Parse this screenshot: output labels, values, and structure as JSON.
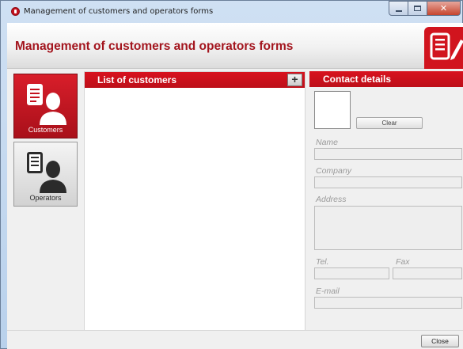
{
  "window": {
    "title": "Management of customers and operators forms",
    "accent_color": "#d1141e"
  },
  "header": {
    "title": "Management of customers and operators forms",
    "logo_icon": "document-pen-icon"
  },
  "nav": {
    "items": [
      {
        "label": "Customers",
        "icon": "customer-document-icon",
        "active": true
      },
      {
        "label": "Operators",
        "icon": "operator-document-icon",
        "active": false
      }
    ]
  },
  "list_panel": {
    "title": "List of customers",
    "add_icon": "plus-icon",
    "items": []
  },
  "contact_panel": {
    "title": "Contact details",
    "clear_label": "Clear",
    "fields": {
      "name": {
        "label": "Name",
        "value": ""
      },
      "company": {
        "label": "Company",
        "value": ""
      },
      "address": {
        "label": "Address",
        "value": ""
      },
      "tel": {
        "label": "Tel.",
        "value": ""
      },
      "fax": {
        "label": "Fax",
        "value": ""
      },
      "email": {
        "label": "E-mail",
        "value": ""
      }
    }
  },
  "footer": {
    "close_label": "Close"
  }
}
